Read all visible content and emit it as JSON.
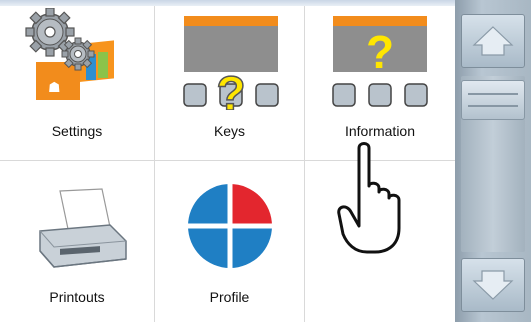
{
  "tiles": {
    "settings": {
      "label": "Settings"
    },
    "keys": {
      "label": "Keys"
    },
    "information": {
      "label": "Information"
    },
    "printouts": {
      "label": "Printouts"
    },
    "profile": {
      "label": "Profile"
    }
  },
  "icons": {
    "settings": "gears-icon",
    "keys": "keypad-help-icon",
    "information": "display-help-icon",
    "printouts": "printer-icon",
    "profile": "profile-disc-icon",
    "pointer": "hand-pointer-icon"
  },
  "colors": {
    "accent_orange": "#f28c1c",
    "help_yellow": "#ffe600",
    "profile_blue": "#1f7fc4",
    "profile_red": "#e3262e"
  }
}
